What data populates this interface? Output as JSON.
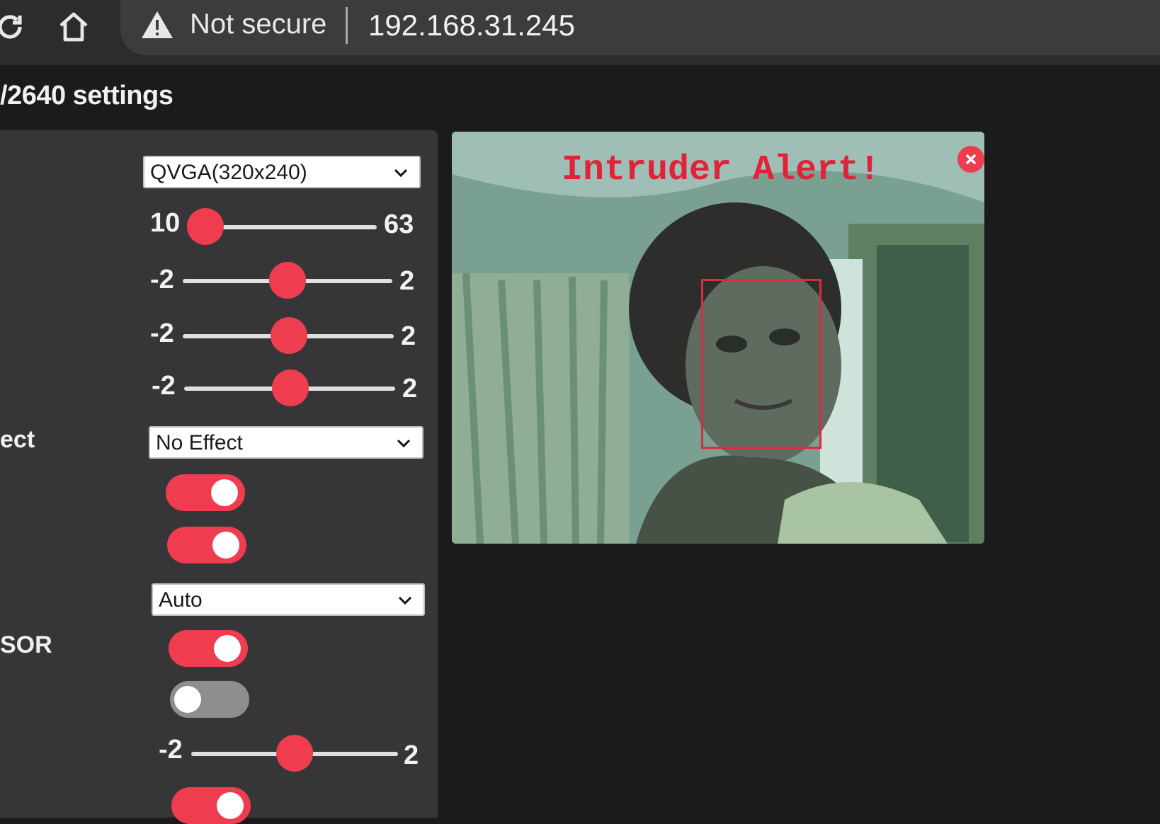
{
  "browser": {
    "security_label": "Not secure",
    "url": "192.168.31.245"
  },
  "page": {
    "title": "/2640 settings"
  },
  "settings": {
    "resolution": {
      "selected": "QVGA(320x240)"
    },
    "quality": {
      "min": "10",
      "max": "63",
      "value_fraction": 0.0
    },
    "brightness": {
      "min": "-2",
      "max": "2",
      "value": 0
    },
    "contrast": {
      "min": "-2",
      "max": "2",
      "value": 0
    },
    "saturation": {
      "min": "-2",
      "max": "2",
      "value": 0
    },
    "special_effect": {
      "label": "ect",
      "selected": "No Effect"
    },
    "toggle_1": {
      "state": "on"
    },
    "toggle_2": {
      "state": "on"
    },
    "wb_mode": {
      "selected": "Auto"
    },
    "sensor_toggle": {
      "label": "SOR",
      "state": "on"
    },
    "toggle_4": {
      "state": "off"
    },
    "ae_level": {
      "min": "-2",
      "max": "2",
      "value": 0
    },
    "toggle_5": {
      "state": "on"
    }
  },
  "stream": {
    "alert_text": "Intruder Alert!",
    "close_icon": "close-icon"
  },
  "colors": {
    "accent": "#ef3d4f",
    "background": "#1b1a1c",
    "panel": "#363638"
  }
}
